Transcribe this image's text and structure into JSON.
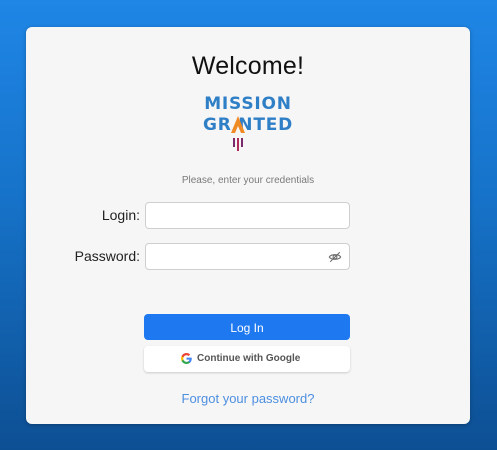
{
  "login_card": {
    "title": "Welcome!",
    "logo": {
      "line1": "MISSION",
      "line2": "GR NTED",
      "icon": "rocket-icon",
      "brand_color": "#2f7fc7",
      "accent_color": "#f08a24"
    },
    "hint": "Please, enter your credentials",
    "fields": {
      "login_label": "Login:",
      "login_value": "",
      "password_label": "Password:",
      "password_value": "",
      "password_toggle_icon": "eye-slash-icon"
    },
    "buttons": {
      "login_label": "Log In",
      "google_label": "Continue with Google",
      "google_icon": "google-icon"
    },
    "forgot_link": "Forgot your password?"
  },
  "colors": {
    "background_top": "#1f86e6",
    "background_bottom": "#0d4f93",
    "primary": "#1e78f0",
    "link": "#4d8fe0"
  }
}
